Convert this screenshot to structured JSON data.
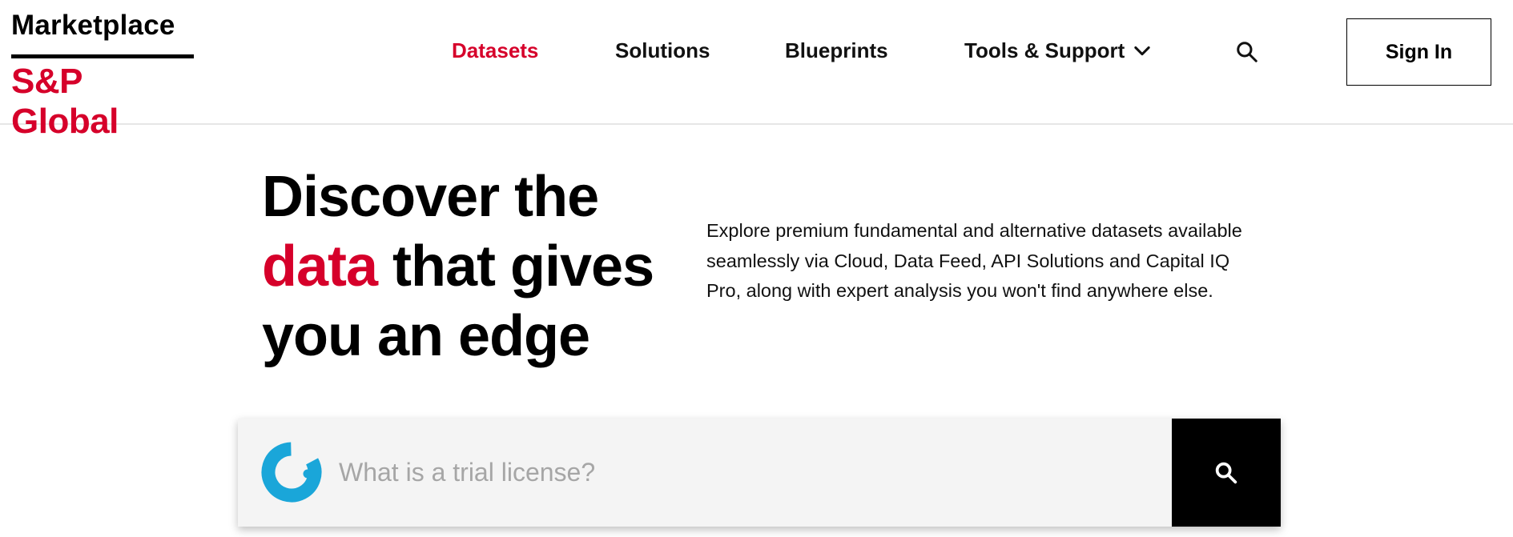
{
  "header": {
    "logo_top": "Marketplace",
    "logo_bottom": "S&P Global",
    "nav": [
      {
        "label": "Datasets",
        "active": true
      },
      {
        "label": "Solutions",
        "active": false
      },
      {
        "label": "Blueprints",
        "active": false
      },
      {
        "label": "Tools & Support",
        "active": false,
        "icon": "chevron-down-icon"
      }
    ],
    "search_icon": "search-icon",
    "signin_label": "Sign In"
  },
  "hero": {
    "title_line1": "Discover the",
    "title_accent": "data",
    "title_line2_rest": " that gives",
    "title_line3": "you an edge",
    "description": "Explore premium fundamental and alternative datasets available seamlessly via Cloud, Data Feed, API Solutions and Capital IQ Pro, along with expert analysis you won't find anywhere else."
  },
  "search": {
    "placeholder": "What is a trial license?",
    "value": "",
    "logo_icon": "ai-assistant-logo-icon",
    "submit_icon": "search-icon"
  },
  "colors": {
    "brand_red": "#d6002a",
    "text": "#000000",
    "search_bg": "#f4f4f4",
    "search_button": "#000000",
    "assistant_blue": "#1aa6d9"
  }
}
